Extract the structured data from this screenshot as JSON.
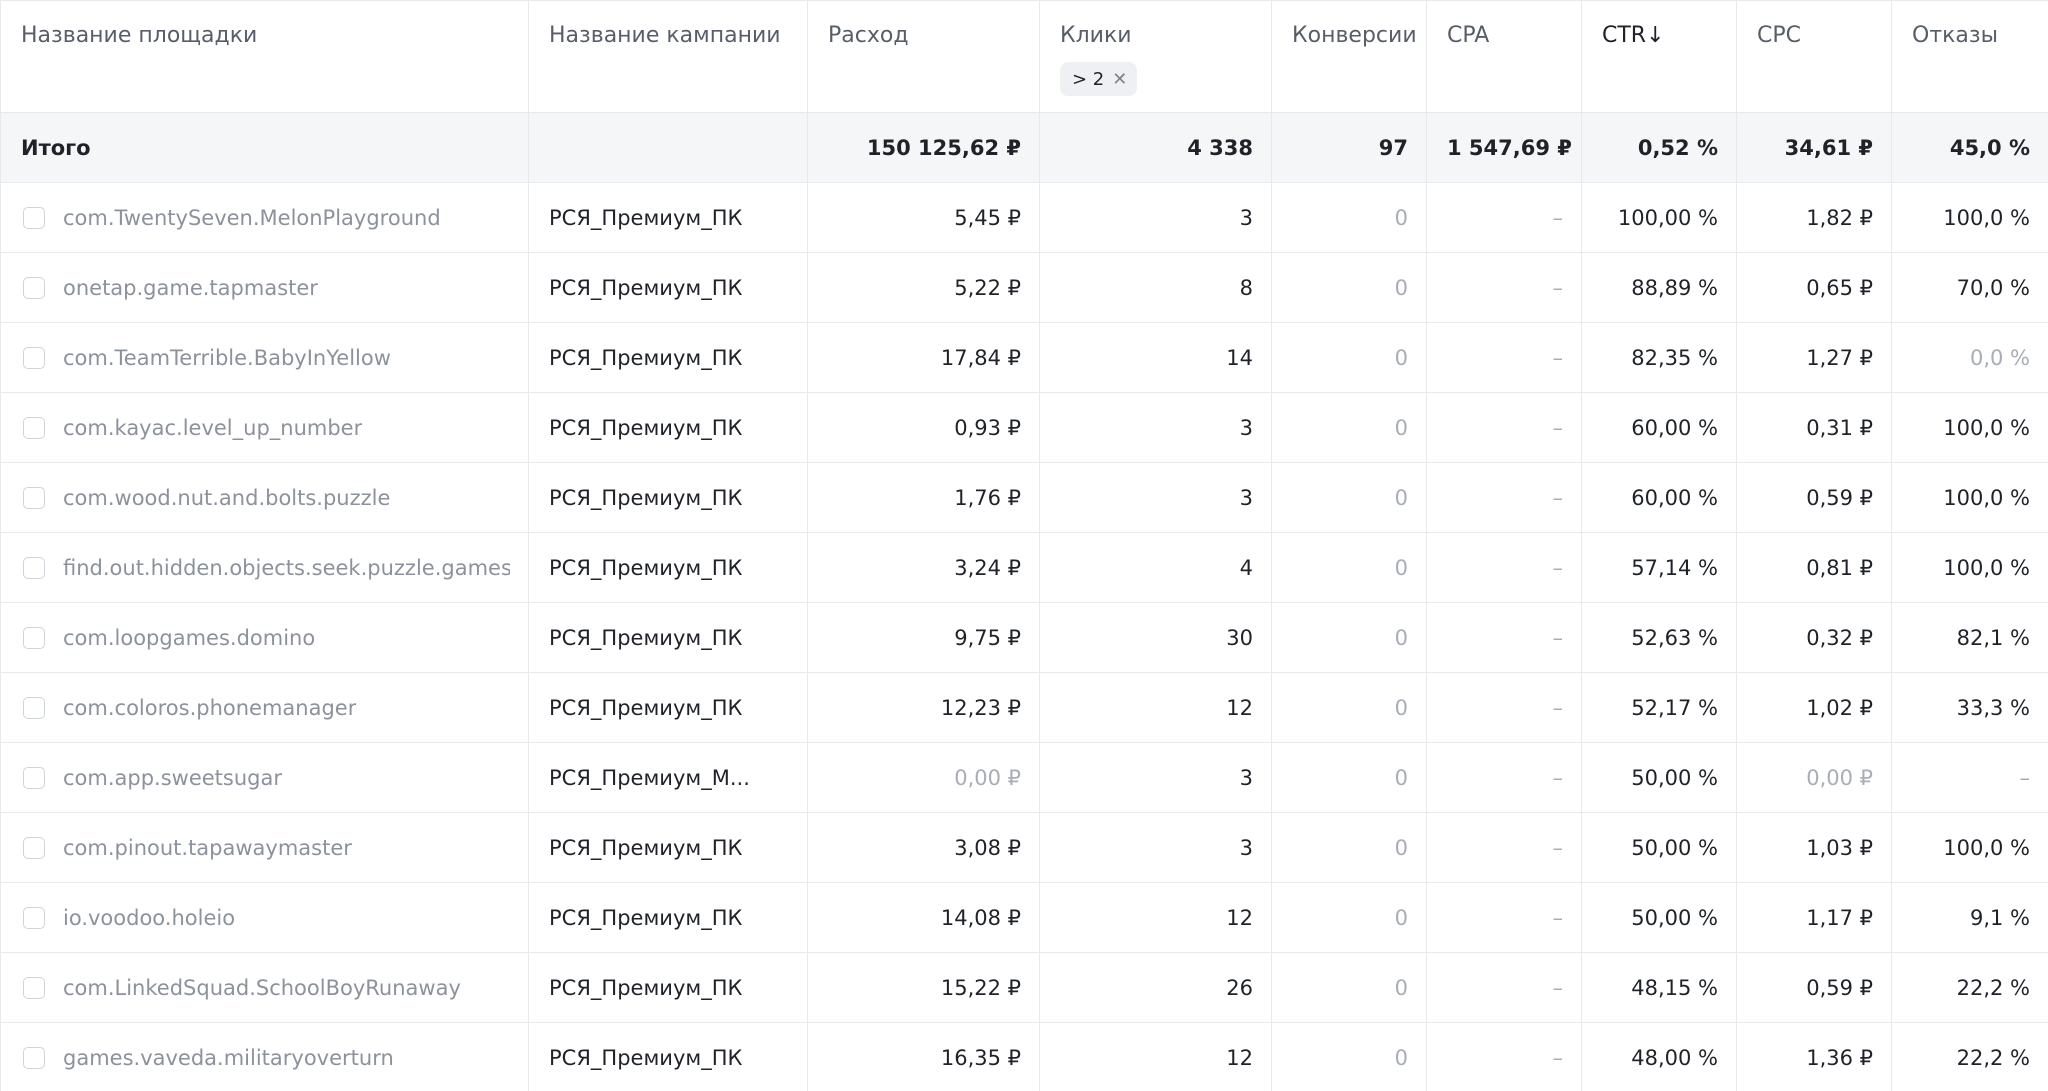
{
  "headers": {
    "site": "Название площадки",
    "campaign": "Название кампании",
    "cost": "Расход",
    "clicks": "Клики",
    "clicks_filter": "> 2",
    "conversions": "Конверсии",
    "cpa": "CPA",
    "ctr": "CTR↓",
    "cpc": "CPC",
    "bounce": "Отказы"
  },
  "total": {
    "label": "Итого",
    "campaign": "",
    "cost": "150 125,62 ₽",
    "clicks": "4 338",
    "conversions": "97",
    "cpa": "1 547,69 ₽",
    "ctr": "0,52 %",
    "cpc": "34,61 ₽",
    "bounce": "45,0 %"
  },
  "rows": [
    {
      "site": "com.TwentySeven.MelonPlayground",
      "campaign": "РСЯ_Премиум_ПК",
      "cost": "5,45 ₽",
      "clicks": "3",
      "conversions": "0",
      "cpa": "–",
      "ctr": "100,00 %",
      "cpc": "1,82 ₽",
      "bounce": "100,0 %"
    },
    {
      "site": "onetap.game.tapmaster",
      "campaign": "РСЯ_Премиум_ПК",
      "cost": "5,22 ₽",
      "clicks": "8",
      "conversions": "0",
      "cpa": "–",
      "ctr": "88,89 %",
      "cpc": "0,65 ₽",
      "bounce": "70,0 %"
    },
    {
      "site": "com.TeamTerrible.BabyInYellow",
      "campaign": "РСЯ_Премиум_ПК",
      "cost": "17,84 ₽",
      "clicks": "14",
      "conversions": "0",
      "cpa": "–",
      "ctr": "82,35 %",
      "cpc": "1,27 ₽",
      "bounce": "0,0 %"
    },
    {
      "site": "com.kayac.level_up_number",
      "campaign": "РСЯ_Премиум_ПК",
      "cost": "0,93 ₽",
      "clicks": "3",
      "conversions": "0",
      "cpa": "–",
      "ctr": "60,00 %",
      "cpc": "0,31 ₽",
      "bounce": "100,0 %"
    },
    {
      "site": "com.wood.nut.and.bolts.puzzle",
      "campaign": "РСЯ_Премиум_ПК",
      "cost": "1,76 ₽",
      "clicks": "3",
      "conversions": "0",
      "cpa": "–",
      "ctr": "60,00 %",
      "cpc": "0,59 ₽",
      "bounce": "100,0 %"
    },
    {
      "site": "find.out.hidden.objects.seek.puzzle.games.fre",
      "campaign": "РСЯ_Премиум_ПК",
      "cost": "3,24 ₽",
      "clicks": "4",
      "conversions": "0",
      "cpa": "–",
      "ctr": "57,14 %",
      "cpc": "0,81 ₽",
      "bounce": "100,0 %"
    },
    {
      "site": "com.loopgames.domino",
      "campaign": "РСЯ_Премиум_ПК",
      "cost": "9,75 ₽",
      "clicks": "30",
      "conversions": "0",
      "cpa": "–",
      "ctr": "52,63 %",
      "cpc": "0,32 ₽",
      "bounce": "82,1 %"
    },
    {
      "site": "com.coloros.phonemanager",
      "campaign": "РСЯ_Премиум_ПК",
      "cost": "12,23 ₽",
      "clicks": "12",
      "conversions": "0",
      "cpa": "–",
      "ctr": "52,17 %",
      "cpc": "1,02 ₽",
      "bounce": "33,3 %"
    },
    {
      "site": "com.app.sweetsugar",
      "campaign": "РСЯ_Премиум_М...",
      "cost": "0,00 ₽",
      "clicks": "3",
      "conversions": "0",
      "cpa": "–",
      "ctr": "50,00 %",
      "cpc": "0,00 ₽",
      "bounce": "–"
    },
    {
      "site": "com.pinout.tapawaymaster",
      "campaign": "РСЯ_Премиум_ПК",
      "cost": "3,08 ₽",
      "clicks": "3",
      "conversions": "0",
      "cpa": "–",
      "ctr": "50,00 %",
      "cpc": "1,03 ₽",
      "bounce": "100,0 %"
    },
    {
      "site": "io.voodoo.holeio",
      "campaign": "РСЯ_Премиум_ПК",
      "cost": "14,08 ₽",
      "clicks": "12",
      "conversions": "0",
      "cpa": "–",
      "ctr": "50,00 %",
      "cpc": "1,17 ₽",
      "bounce": "9,1 %"
    },
    {
      "site": "com.LinkedSquad.SchoolBoyRunaway",
      "campaign": "РСЯ_Премиум_ПК",
      "cost": "15,22 ₽",
      "clicks": "26",
      "conversions": "0",
      "cpa": "–",
      "ctr": "48,15 %",
      "cpc": "0,59 ₽",
      "bounce": "22,2 %"
    },
    {
      "site": "games.vaveda.militaryoverturn",
      "campaign": "РСЯ_Премиум_ПК",
      "cost": "16,35 ₽",
      "clicks": "12",
      "conversions": "0",
      "cpa": "–",
      "ctr": "48,00 %",
      "cpc": "1,36 ₽",
      "bounce": "22,2 %"
    }
  ],
  "muted_values": [
    "0",
    "0,00 ₽",
    "0,0 %",
    "–"
  ],
  "colors": {
    "header_text": "#585e69",
    "muted_text": "#a8adb6",
    "site_text": "#8c929c",
    "total_bg": "#f5f6f8",
    "border": "#e7e9ee"
  }
}
